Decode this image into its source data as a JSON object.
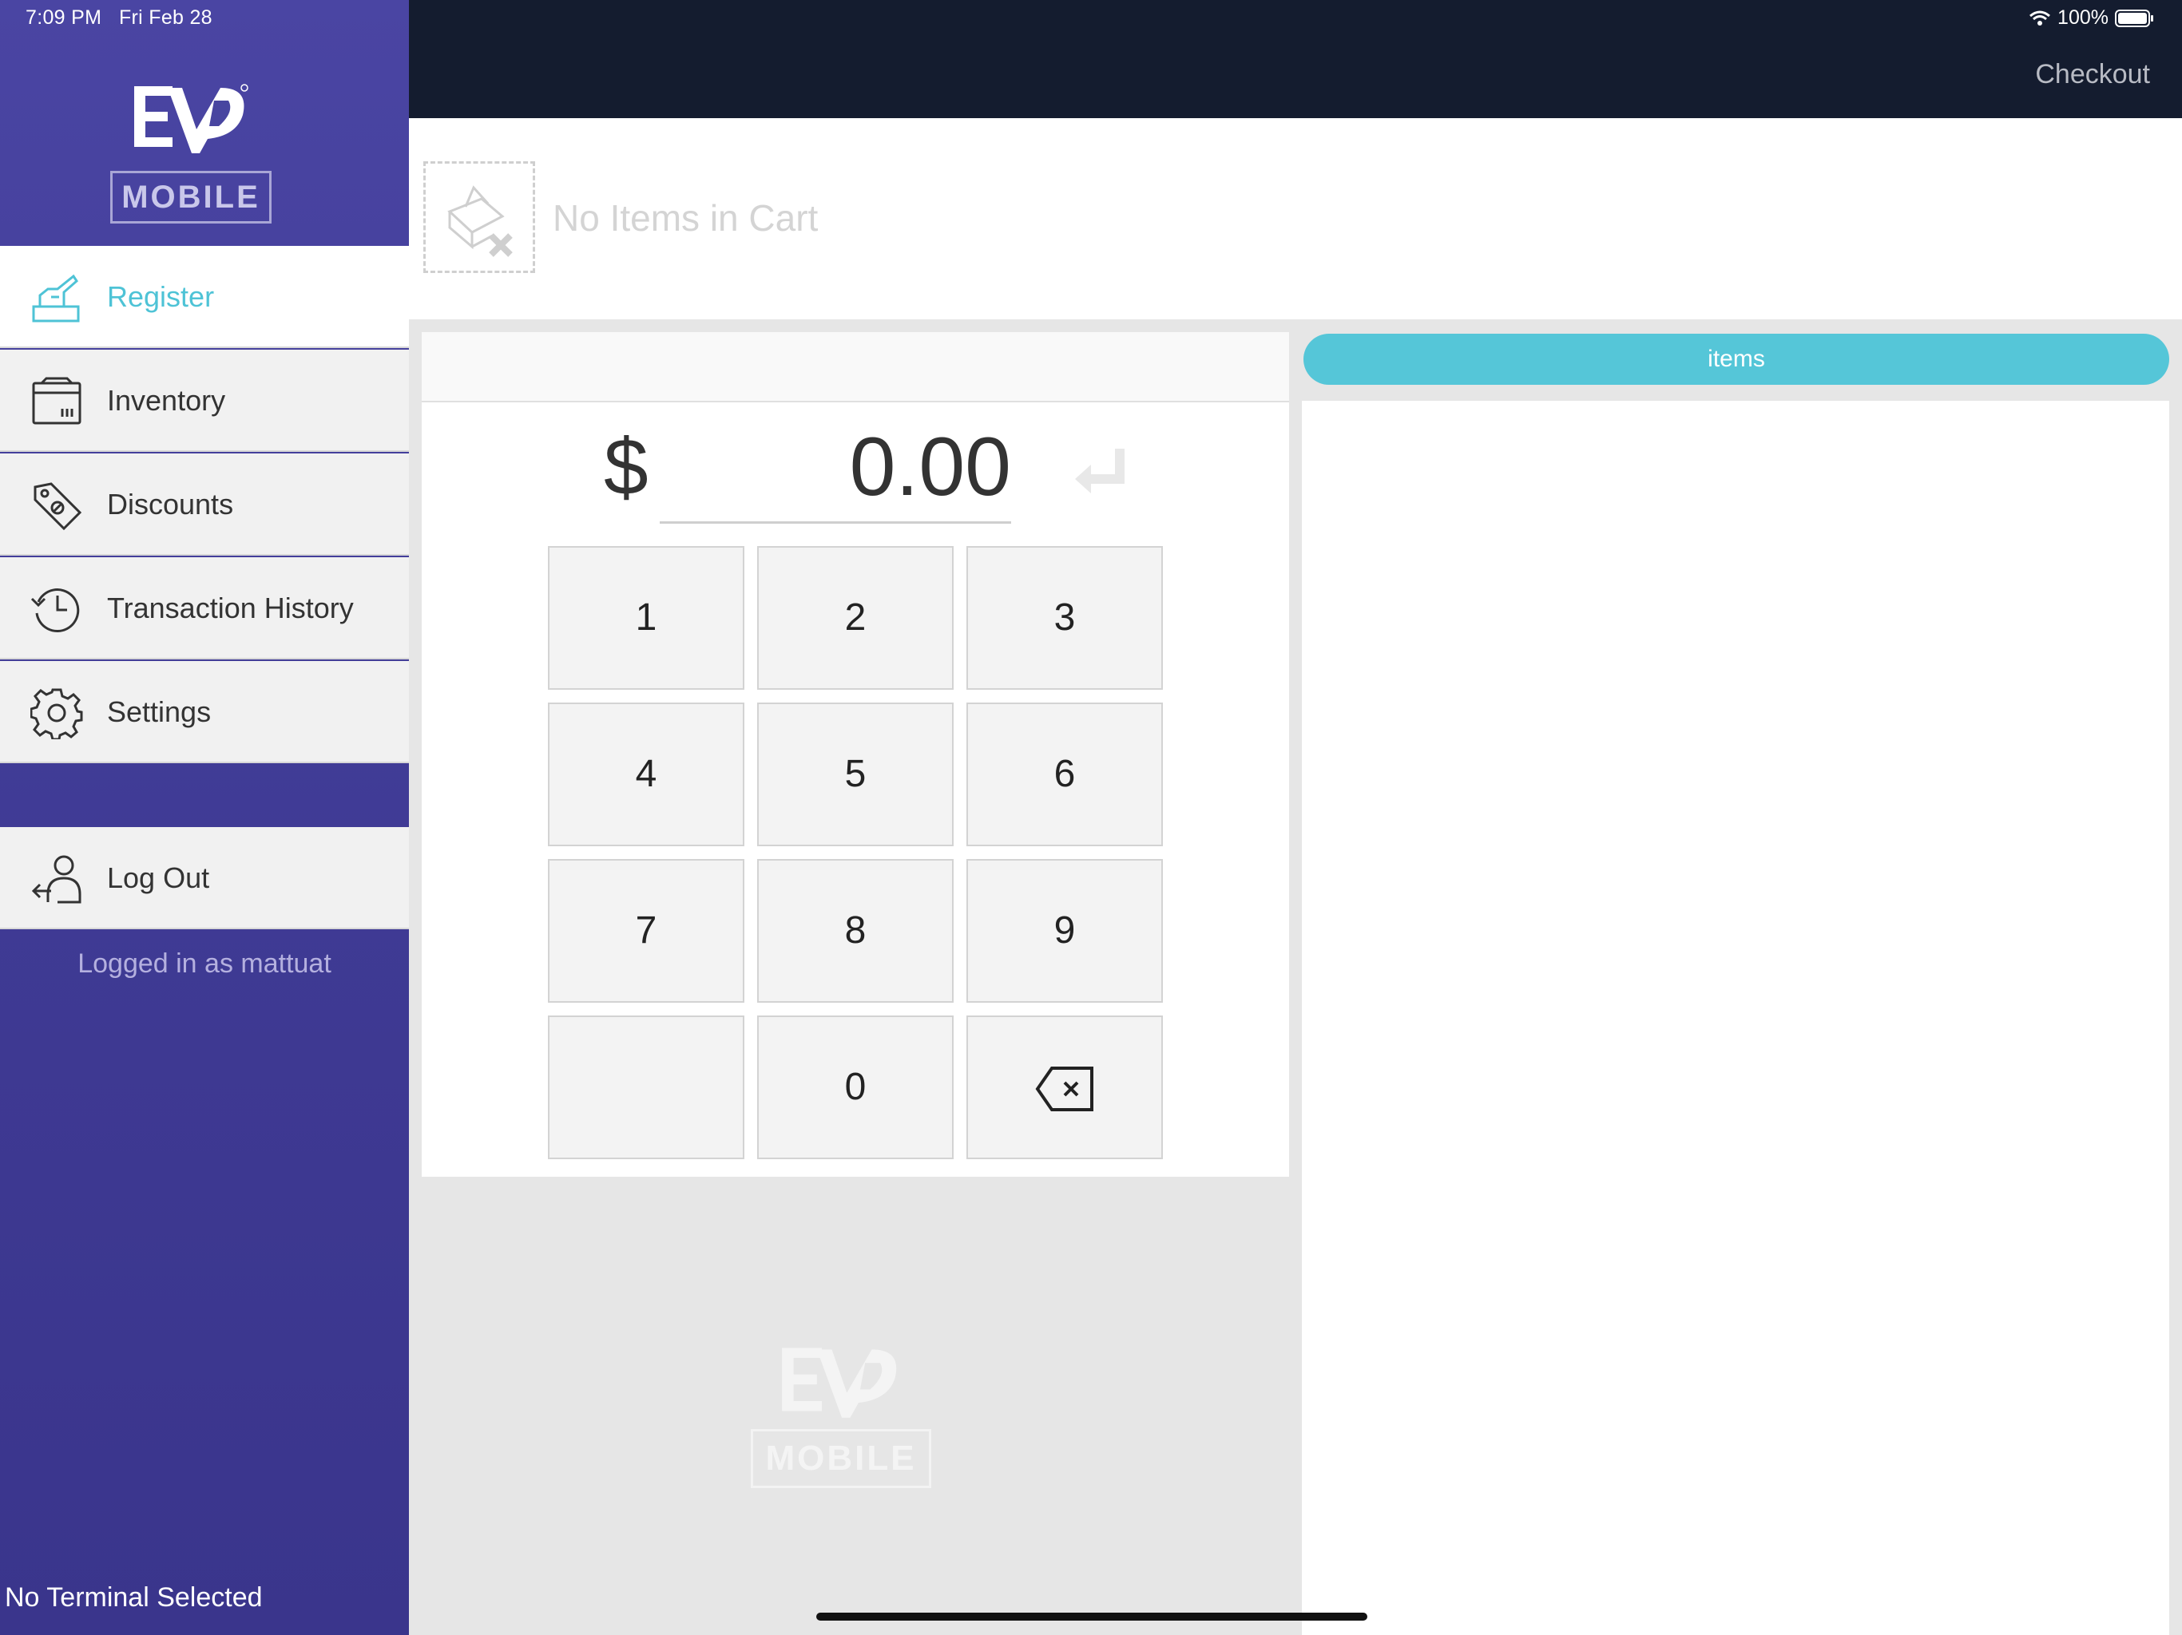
{
  "status_bar": {
    "time": "7:09 PM",
    "date": "Fri Feb 28",
    "battery": "100%",
    "icons": [
      "wifi-icon",
      "battery-icon"
    ]
  },
  "brand": {
    "logo_text": "EVO",
    "product": "MOBILE",
    "accent_color": "#55c6d8",
    "sidebar_color": "#4441a0",
    "topbar_color": "#141c2f"
  },
  "sidebar": {
    "items": [
      {
        "label": "Register",
        "icon": "cash-register-icon",
        "active": true
      },
      {
        "label": "Inventory",
        "icon": "box-icon",
        "active": false
      },
      {
        "label": "Discounts",
        "icon": "discount-tag-icon",
        "active": false
      },
      {
        "label": "Transaction History",
        "icon": "history-icon",
        "active": false
      },
      {
        "label": "Settings",
        "icon": "gear-icon",
        "active": false
      }
    ],
    "logout": {
      "label": "Log Out",
      "icon": "logout-icon"
    },
    "logged_in_text": "Logged in as mattuat",
    "terminal_text": "No Terminal Selected"
  },
  "header": {
    "checkout_label": "Checkout"
  },
  "cart": {
    "empty_text": "No Items in Cart",
    "icon": "empty-cart-icon"
  },
  "keypad": {
    "currency_symbol": "$",
    "amount": "0.00",
    "keys": [
      "1",
      "2",
      "3",
      "4",
      "5",
      "6",
      "7",
      "8",
      "9",
      "",
      "0",
      "backspace"
    ]
  },
  "items_panel": {
    "tab_label": "items"
  }
}
